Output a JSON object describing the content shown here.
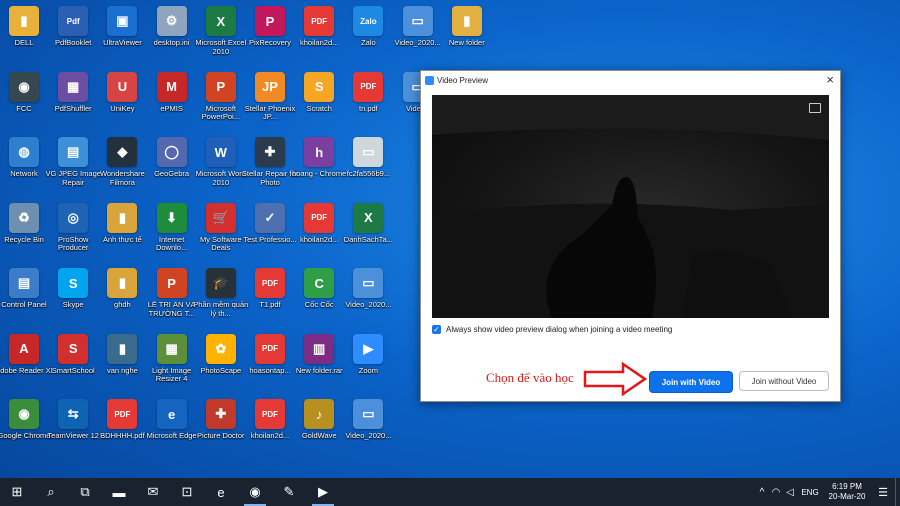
{
  "desktop_icons": [
    {
      "id": "dell",
      "label": "DELL",
      "col": 0,
      "row": 0,
      "color": "#e8b23a",
      "glyph": "▮"
    },
    {
      "id": "pdfbooklet",
      "label": "PdfBooklet",
      "col": 1,
      "row": 0,
      "color": "#2b5fb3",
      "glyph": "Pdf"
    },
    {
      "id": "ultraviewer",
      "label": "UltraViewer",
      "col": 2,
      "row": 0,
      "color": "#1b6fd0",
      "glyph": "▣"
    },
    {
      "id": "desktopini",
      "label": "desktop.ini",
      "col": 3,
      "row": 0,
      "color": "#8fa4bf",
      "glyph": "⚙"
    },
    {
      "id": "excel",
      "label": "Microsoft Excel 2010",
      "col": 4,
      "row": 0,
      "color": "#1d7a45",
      "glyph": "X"
    },
    {
      "id": "pixrecovery",
      "label": "PixRecovery",
      "col": 5,
      "row": 0,
      "color": "#c2185b",
      "glyph": "P"
    },
    {
      "id": "khoi1",
      "label": "khoilan2d...",
      "col": 6,
      "row": 0,
      "color": "#e53935",
      "glyph": "PDF"
    },
    {
      "id": "zalo",
      "label": "Zalo",
      "col": 7,
      "row": 0,
      "color": "#1e88e5",
      "glyph": "Zalo"
    },
    {
      "id": "video1",
      "label": "Video_2020...",
      "col": 8,
      "row": 0,
      "color": "#4c8fdb",
      "glyph": "▭"
    },
    {
      "id": "newfolder",
      "label": "New folder",
      "col": 9,
      "row": 0,
      "color": "#e3b143",
      "glyph": "▮"
    },
    {
      "id": "fcc",
      "label": "FCC",
      "col": 0,
      "row": 1,
      "color": "#37474f",
      "glyph": "◉"
    },
    {
      "id": "pdfshuffler",
      "label": "PdfShuffler",
      "col": 1,
      "row": 1,
      "color": "#6a4ea3",
      "glyph": "▦"
    },
    {
      "id": "unikey",
      "label": "UniKey",
      "col": 2,
      "row": 1,
      "color": "#d84343",
      "glyph": "U"
    },
    {
      "id": "epmis",
      "label": "ePMIS",
      "col": 3,
      "row": 1,
      "color": "#c62828",
      "glyph": "M"
    },
    {
      "id": "powerpoint",
      "label": "Microsoft PowerPoi...",
      "col": 4,
      "row": 1,
      "color": "#d04423",
      "glyph": "P"
    },
    {
      "id": "stellarjpeg",
      "label": "Stellar Phoenix JP...",
      "col": 5,
      "row": 1,
      "color": "#f08a24",
      "glyph": "JP"
    },
    {
      "id": "scratch",
      "label": "Scratch",
      "col": 6,
      "row": 1,
      "color": "#f6a623",
      "glyph": "S"
    },
    {
      "id": "tn",
      "label": "tn.pdf",
      "col": 7,
      "row": 1,
      "color": "#e53935",
      "glyph": "PDF"
    },
    {
      "id": "video2",
      "label": "Video_",
      "col": 8,
      "row": 1,
      "color": "#4c8fdb",
      "glyph": "▭"
    },
    {
      "id": "network",
      "label": "Network",
      "col": 0,
      "row": 2,
      "color": "#2f7fd1",
      "glyph": "◍"
    },
    {
      "id": "vgjpeg",
      "label": "VG JPEG Image Repair",
      "col": 1,
      "row": 2,
      "color": "#3d8fd8",
      "glyph": "▤"
    },
    {
      "id": "filmora",
      "label": "Wondershare Filmora",
      "col": 2,
      "row": 2,
      "color": "#23313f",
      "glyph": "◆"
    },
    {
      "id": "geogebra",
      "label": "GeoGebra",
      "col": 3,
      "row": 2,
      "color": "#5468b0",
      "glyph": "◯"
    },
    {
      "id": "word",
      "label": "Microsoft Word 2010",
      "col": 4,
      "row": 2,
      "color": "#1f5fb8",
      "glyph": "W"
    },
    {
      "id": "stellarphoto",
      "label": "Stellar Repair for Photo",
      "col": 5,
      "row": 2,
      "color": "#2b3a4d",
      "glyph": "✚"
    },
    {
      "id": "chromehoang",
      "label": "hoang - Chrome",
      "col": 6,
      "row": 2,
      "color": "#7b3fa0",
      "glyph": "h"
    },
    {
      "id": "fc2fa",
      "label": "fc2fa556b9...",
      "col": 7,
      "row": 2,
      "color": "#cfd6de",
      "glyph": "▭"
    },
    {
      "id": "recycle",
      "label": "Recycle Bin",
      "col": 0,
      "row": 3,
      "color": "#6f8fb0",
      "glyph": "♻"
    },
    {
      "id": "proshow",
      "label": "ProShow Producer",
      "col": 1,
      "row": 3,
      "color": "#1f63b5",
      "glyph": "◎"
    },
    {
      "id": "anhthucte",
      "label": "Ảnh thực tế",
      "col": 2,
      "row": 3,
      "color": "#d9a53a",
      "glyph": "▮"
    },
    {
      "id": "idm",
      "label": "Internet Downlo...",
      "col": 3,
      "row": 3,
      "color": "#1e8c3a",
      "glyph": "⬇"
    },
    {
      "id": "mysoftware",
      "label": "My Software Deals",
      "col": 4,
      "row": 3,
      "color": "#d32f2f",
      "glyph": "🛒"
    },
    {
      "id": "testpro",
      "label": "Test Professio...",
      "col": 5,
      "row": 3,
      "color": "#4e6fb0",
      "glyph": "✓"
    },
    {
      "id": "khoi2",
      "label": "khoilan2d...",
      "col": 6,
      "row": 3,
      "color": "#e53935",
      "glyph": "PDF"
    },
    {
      "id": "danhsach",
      "label": "DanhSachTa...",
      "col": 7,
      "row": 3,
      "color": "#1d7a45",
      "glyph": "X"
    },
    {
      "id": "control",
      "label": "Control Panel",
      "col": 0,
      "row": 4,
      "color": "#3c7dc9",
      "glyph": "▤"
    },
    {
      "id": "skype",
      "label": "Skype",
      "col": 1,
      "row": 4,
      "color": "#00a4ef",
      "glyph": "S"
    },
    {
      "id": "ghdh",
      "label": "ghdh",
      "col": 2,
      "row": 4,
      "color": "#d9a53a",
      "glyph": "▮"
    },
    {
      "id": "letrian",
      "label": "LỄ TRI ÂN VÀ TRƯỜNG T...",
      "col": 3,
      "row": 4,
      "color": "#d04423",
      "glyph": "P"
    },
    {
      "id": "phanmem",
      "label": "Phần mềm quản lý th...",
      "col": 4,
      "row": 4,
      "color": "#263238",
      "glyph": "🎓"
    },
    {
      "id": "t1",
      "label": "T1.pdf",
      "col": 5,
      "row": 4,
      "color": "#e53935",
      "glyph": "PDF"
    },
    {
      "id": "coccoc",
      "label": "Cốc Cốc",
      "col": 6,
      "row": 4,
      "color": "#2e9e47",
      "glyph": "C"
    },
    {
      "id": "video3",
      "label": "Video_2020...",
      "col": 7,
      "row": 4,
      "color": "#4c8fdb",
      "glyph": "▭"
    },
    {
      "id": "adobe",
      "label": "Adobe Reader XI",
      "col": 0,
      "row": 5,
      "color": "#c62828",
      "glyph": "A"
    },
    {
      "id": "smartschool",
      "label": "SmartSchool",
      "col": 1,
      "row": 5,
      "color": "#d32f2f",
      "glyph": "S"
    },
    {
      "id": "vannghe",
      "label": "van nghe",
      "col": 2,
      "row": 5,
      "color": "#3a6b8c",
      "glyph": "▮"
    },
    {
      "id": "lightimage",
      "label": "Light Image Resizer 4",
      "col": 3,
      "row": 5,
      "color": "#5d8f3a",
      "glyph": "▦"
    },
    {
      "id": "photoscape",
      "label": "PhotoScape",
      "col": 4,
      "row": 5,
      "color": "#ffb300",
      "glyph": "✿"
    },
    {
      "id": "hoasontap",
      "label": "hoasontap...",
      "col": 5,
      "row": 5,
      "color": "#e53935",
      "glyph": "PDF"
    },
    {
      "id": "newfolderrar",
      "label": "New folder.rar",
      "col": 6,
      "row": 5,
      "color": "#7b2d86",
      "glyph": "▥"
    },
    {
      "id": "zoom",
      "label": "Zoom",
      "col": 7,
      "row": 5,
      "color": "#2d8cff",
      "glyph": "▶"
    },
    {
      "id": "chrome",
      "label": "Google Chrome",
      "col": 0,
      "row": 6,
      "color": "#3b8d3b",
      "glyph": "◉"
    },
    {
      "id": "teamviewer",
      "label": "TeamViewer 12",
      "col": 1,
      "row": 6,
      "color": "#0e63b3",
      "glyph": "⇆"
    },
    {
      "id": "bdhhhh",
      "label": "BDHHHH.pdf",
      "col": 2,
      "row": 6,
      "color": "#e53935",
      "glyph": "PDF"
    },
    {
      "id": "edge",
      "label": "Microsoft Edge",
      "col": 3,
      "row": 6,
      "color": "#1565c0",
      "glyph": "e"
    },
    {
      "id": "picturedoctor",
      "label": "Picture Doctor",
      "col": 4,
      "row": 6,
      "color": "#c0392b",
      "glyph": "✚"
    },
    {
      "id": "khoi3",
      "label": "khoilan2d...",
      "col": 5,
      "row": 6,
      "color": "#e53935",
      "glyph": "PDF"
    },
    {
      "id": "goldwave",
      "label": "GoldWave",
      "col": 6,
      "row": 6,
      "color": "#b8901f",
      "glyph": "♪"
    },
    {
      "id": "video4",
      "label": "Video_2020...",
      "col": 7,
      "row": 6,
      "color": "#4c8fdb",
      "glyph": "▭"
    }
  ],
  "dialog": {
    "title": "Video Preview",
    "close_glyph": "×",
    "checkbox_checked": true,
    "checkbox_label": "Always show video preview dialog when joining a video meeting",
    "join_with_video": "Join with Video",
    "join_without_video": "Join without Video"
  },
  "annotation": {
    "text": "Chọn để vào học",
    "color": "#e01818"
  },
  "taskbar": {
    "items": [
      {
        "name": "start-button",
        "glyph": "⊞",
        "active": false
      },
      {
        "name": "search-button",
        "glyph": "⌕",
        "active": false
      },
      {
        "name": "task-view-button",
        "glyph": "⧉",
        "active": false
      },
      {
        "name": "taskbar-file-explorer",
        "glyph": "▬",
        "active": false
      },
      {
        "name": "taskbar-mail",
        "glyph": "✉",
        "active": false
      },
      {
        "name": "taskbar-store",
        "glyph": "⊡",
        "active": false
      },
      {
        "name": "taskbar-edge",
        "glyph": "e",
        "active": false
      },
      {
        "name": "taskbar-chrome",
        "glyph": "◉",
        "active": true
      },
      {
        "name": "taskbar-app",
        "glyph": "✎",
        "active": false
      },
      {
        "name": "taskbar-zoom",
        "glyph": "▶",
        "active": true
      }
    ],
    "tray": {
      "chevron": "^",
      "wifi": "◠",
      "volume": "◁",
      "language": "ENG",
      "time": "6:19 PM",
      "date": "20-Mar-20",
      "notification_glyph": "☰"
    }
  }
}
